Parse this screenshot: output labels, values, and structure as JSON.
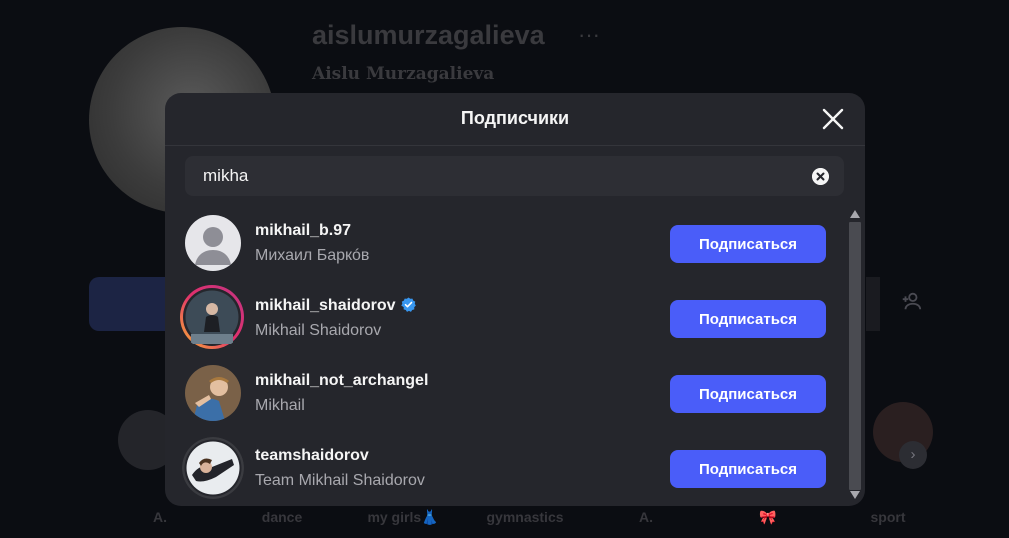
{
  "background_profile": {
    "username": "aislumurzagalieva",
    "more_label": "···",
    "full_name": "Aislu Murzagalieva",
    "highlights": [
      "A.",
      "dance",
      "my girls👗",
      "gymnastics",
      "A.",
      "🎀",
      "sport"
    ]
  },
  "modal": {
    "title": "Подписчики",
    "close_icon": "close-icon",
    "search": {
      "value": "mikha",
      "placeholder": "Поиск",
      "clear_icon": "clear-circle-icon"
    },
    "follow_button_color": "#4a5df9",
    "verified_color": "#3897f0",
    "rows": [
      {
        "username": "mikhail_b.97",
        "full_name": "Михаил Баркóв",
        "verified": false,
        "story_ring": false,
        "button": "Подписаться"
      },
      {
        "username": "mikhail_shaidorov",
        "full_name": "Mikhail Shaidorov",
        "verified": true,
        "story_ring": true,
        "button": "Подписаться"
      },
      {
        "username": "mikhail_not_archangel",
        "full_name": "Mikhail",
        "verified": false,
        "story_ring": false,
        "button": "Подписаться"
      },
      {
        "username": "teamshaidorov",
        "full_name": "Team Mikhail Shaidorov",
        "verified": false,
        "story_ring": false,
        "button": "Подписаться"
      }
    ]
  }
}
